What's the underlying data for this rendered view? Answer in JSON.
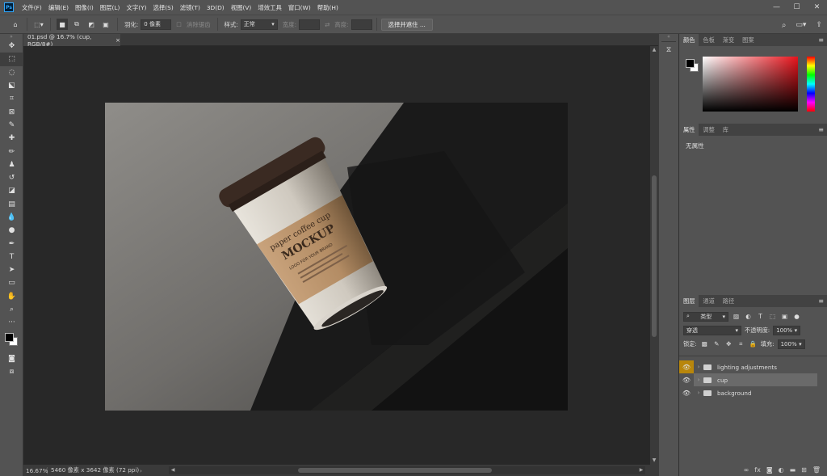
{
  "app": {
    "logo": "Ps"
  },
  "menu": [
    "文件(F)",
    "编辑(E)",
    "图像(I)",
    "图层(L)",
    "文字(Y)",
    "选择(S)",
    "滤镜(T)",
    "3D(D)",
    "视图(V)",
    "增效工具",
    "窗口(W)",
    "帮助(H)"
  ],
  "options": {
    "feather_label": "羽化:",
    "feather_value": "0 像素",
    "antialias_label": "消除锯齿",
    "style_label": "样式:",
    "style_value": "正常",
    "width_label": "宽度:",
    "height_label": "高度:",
    "select_mask_button": "选择并遮住 ..."
  },
  "document": {
    "tab_title": "01.psd @ 16.7% (cup, RGB/8#)",
    "cup_text": [
      "paper coffee cup",
      "MOCKUP",
      "LOGO FOR YOUR BRAND"
    ]
  },
  "status": {
    "zoom": "16.67%",
    "info": "5460 像素 x 3642 像素 (72 ppi)"
  },
  "panels": {
    "color_tabs": [
      "颜色",
      "色板",
      "渐变",
      "图案"
    ],
    "props_tabs": [
      "属性",
      "调整",
      "库"
    ],
    "props_empty": "无属性",
    "layers_tabs": [
      "图层",
      "通道",
      "路径"
    ],
    "filter_kind": "类型",
    "blend_mode": "穿透",
    "opacity_label": "不透明度:",
    "opacity_value": "100%",
    "lock_label": "锁定:",
    "fill_label": "填充:",
    "fill_value": "100%",
    "layers": [
      "lighting adjustments",
      "cup",
      "background"
    ],
    "colors": {
      "foreground": "#000000",
      "background": "#ffffff",
      "picker_hue": "#e8141c"
    }
  }
}
